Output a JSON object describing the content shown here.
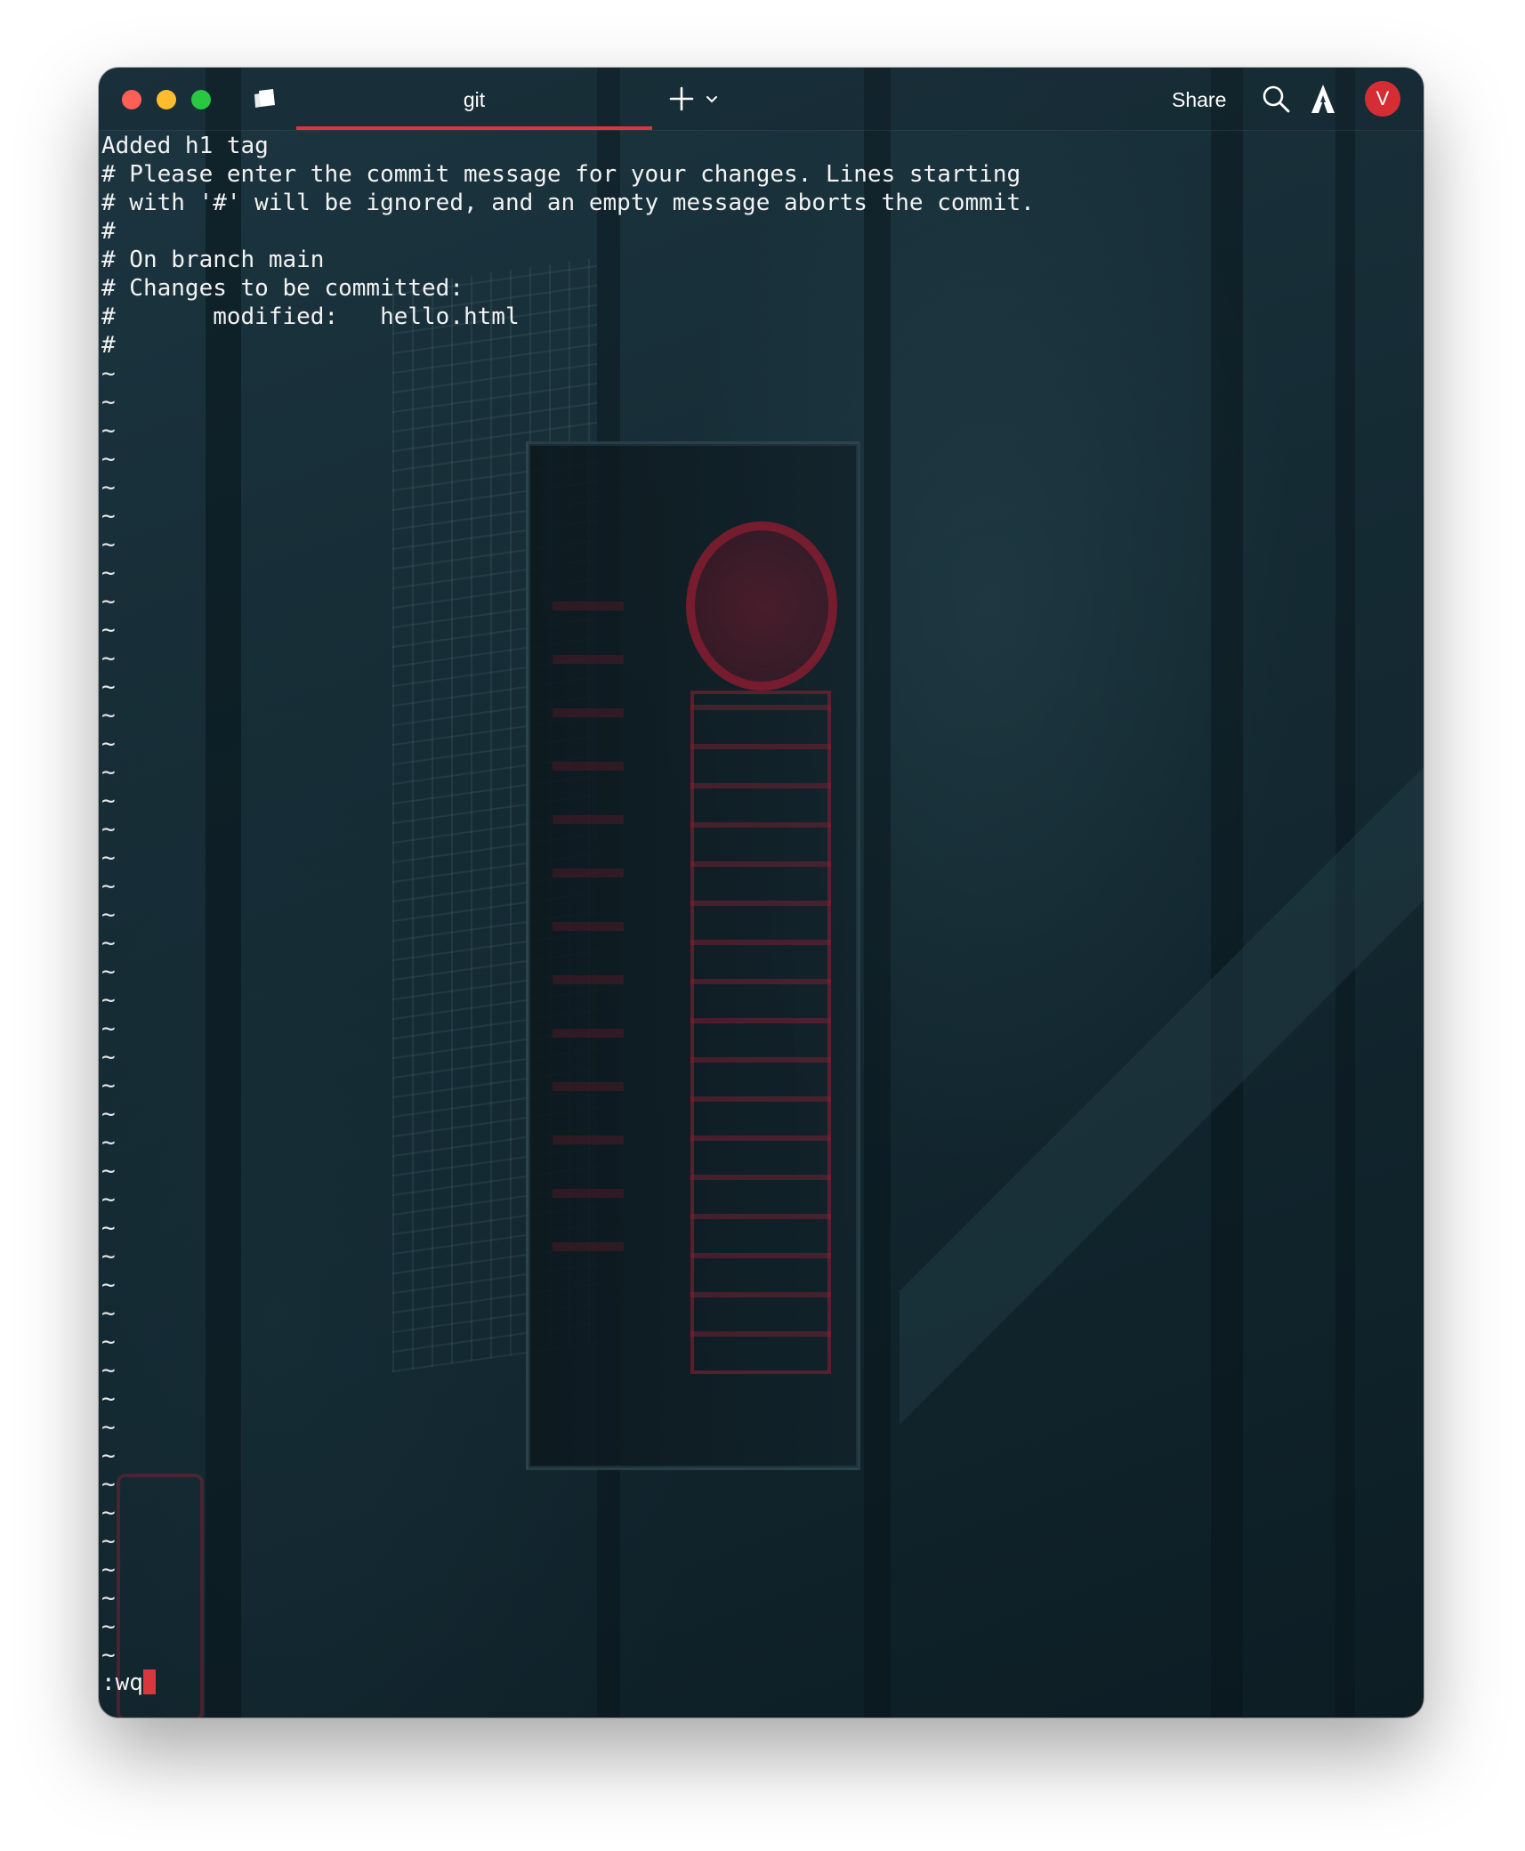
{
  "window": {
    "tab_title": "git",
    "share_label": "Share",
    "avatar_initial": "V",
    "accent_color": "#d9363e",
    "icons": {
      "close": "close-icon",
      "minimize": "minimize-icon",
      "maximize": "maximize-icon",
      "sidebar": "sidebar-toggle-icon",
      "new_tab": "plus-icon",
      "new_tab_menu": "chevron-down-icon",
      "search": "search-icon",
      "ai": "warp-ai-icon"
    }
  },
  "editor": {
    "lines": [
      "Added h1 tag",
      "# Please enter the commit message for your changes. Lines starting",
      "# with '#' will be ignored, and an empty message aborts the commit.",
      "#",
      "# On branch main",
      "# Changes to be committed:",
      "#       modified:   hello.html",
      "#"
    ],
    "empty_line_marker": "~",
    "command": ":wq"
  }
}
